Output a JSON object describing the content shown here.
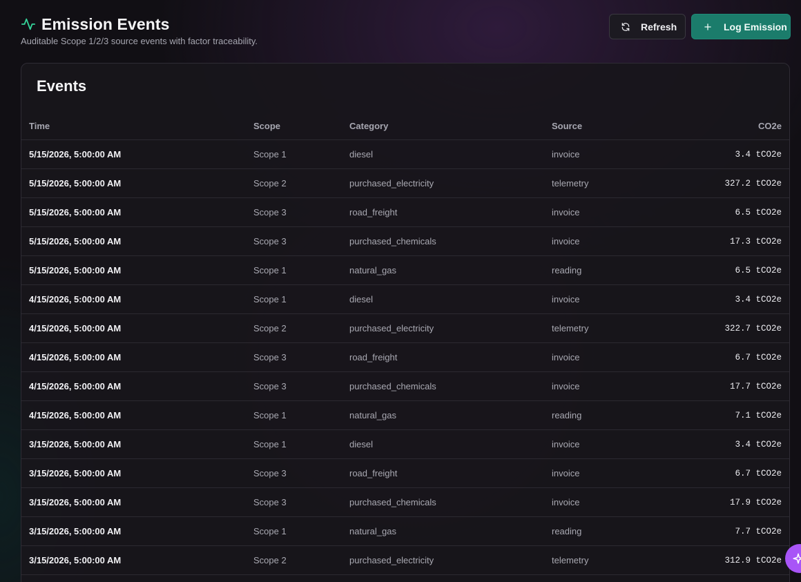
{
  "header": {
    "title": "Emission Events",
    "subtitle": "Auditable Scope 1/2/3 source events with factor traceability.",
    "title_icon": "activity-icon",
    "accent": "#34d399"
  },
  "actions": {
    "refresh_label": "Refresh",
    "refresh_icon": "refresh-icon",
    "log_label": "Log Emission",
    "log_icon": "plus-icon"
  },
  "card": {
    "title": "Events"
  },
  "table": {
    "columns": {
      "time": "Time",
      "scope": "Scope",
      "category": "Category",
      "source": "Source",
      "co2e": "CO2e"
    },
    "rows": [
      {
        "time": "5/15/2026, 5:00:00 AM",
        "scope": "Scope 1",
        "category": "diesel",
        "source": "invoice",
        "co2e": "3.4 tCO2e"
      },
      {
        "time": "5/15/2026, 5:00:00 AM",
        "scope": "Scope 2",
        "category": "purchased_electricity",
        "source": "telemetry",
        "co2e": "327.2 tCO2e"
      },
      {
        "time": "5/15/2026, 5:00:00 AM",
        "scope": "Scope 3",
        "category": "road_freight",
        "source": "invoice",
        "co2e": "6.5 tCO2e"
      },
      {
        "time": "5/15/2026, 5:00:00 AM",
        "scope": "Scope 3",
        "category": "purchased_chemicals",
        "source": "invoice",
        "co2e": "17.3 tCO2e"
      },
      {
        "time": "5/15/2026, 5:00:00 AM",
        "scope": "Scope 1",
        "category": "natural_gas",
        "source": "reading",
        "co2e": "6.5 tCO2e"
      },
      {
        "time": "4/15/2026, 5:00:00 AM",
        "scope": "Scope 1",
        "category": "diesel",
        "source": "invoice",
        "co2e": "3.4 tCO2e"
      },
      {
        "time": "4/15/2026, 5:00:00 AM",
        "scope": "Scope 2",
        "category": "purchased_electricity",
        "source": "telemetry",
        "co2e": "322.7 tCO2e"
      },
      {
        "time": "4/15/2026, 5:00:00 AM",
        "scope": "Scope 3",
        "category": "road_freight",
        "source": "invoice",
        "co2e": "6.7 tCO2e"
      },
      {
        "time": "4/15/2026, 5:00:00 AM",
        "scope": "Scope 3",
        "category": "purchased_chemicals",
        "source": "invoice",
        "co2e": "17.7 tCO2e"
      },
      {
        "time": "4/15/2026, 5:00:00 AM",
        "scope": "Scope 1",
        "category": "natural_gas",
        "source": "reading",
        "co2e": "7.1 tCO2e"
      },
      {
        "time": "3/15/2026, 5:00:00 AM",
        "scope": "Scope 1",
        "category": "diesel",
        "source": "invoice",
        "co2e": "3.4 tCO2e"
      },
      {
        "time": "3/15/2026, 5:00:00 AM",
        "scope": "Scope 3",
        "category": "road_freight",
        "source": "invoice",
        "co2e": "6.7 tCO2e"
      },
      {
        "time": "3/15/2026, 5:00:00 AM",
        "scope": "Scope 3",
        "category": "purchased_chemicals",
        "source": "invoice",
        "co2e": "17.9 tCO2e"
      },
      {
        "time": "3/15/2026, 5:00:00 AM",
        "scope": "Scope 1",
        "category": "natural_gas",
        "source": "reading",
        "co2e": "7.7 tCO2e"
      },
      {
        "time": "3/15/2026, 5:00:00 AM",
        "scope": "Scope 2",
        "category": "purchased_electricity",
        "source": "telemetry",
        "co2e": "312.9 tCO2e"
      }
    ]
  },
  "fab": {
    "icon": "sparkle-icon",
    "color": "#a855f7"
  }
}
